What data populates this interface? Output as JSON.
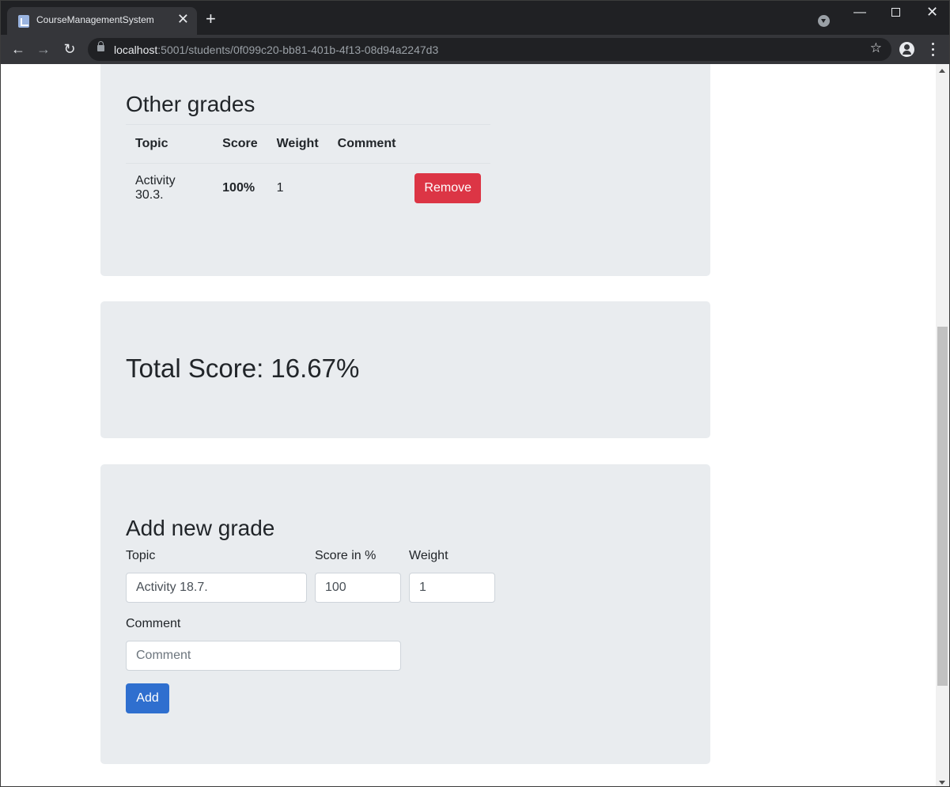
{
  "browser": {
    "tab_title": "CourseManagementSystem",
    "tab_close": "✕",
    "new_tab": "+",
    "url_host": "localhost",
    "url_rest": ":5001/students/0f099c20-bb81-401b-4f13-08d94a2247d3",
    "window_min": "—",
    "window_close": "✕",
    "back": "←",
    "forward": "→",
    "reload": "↻",
    "star": "☆"
  },
  "other_grades": {
    "title": "Other grades",
    "columns": [
      "Topic",
      "Score",
      "Weight",
      "Comment"
    ],
    "rows": [
      {
        "topic": "Activity 30.3.",
        "score": "100%",
        "weight": "1",
        "comment": "",
        "action": "Remove"
      }
    ]
  },
  "total": {
    "text": "Total Score: 16.67%"
  },
  "add_grade": {
    "title": "Add new grade",
    "topic_label": "Topic",
    "topic_value": "Activity 18.7.",
    "score_label": "Score in %",
    "score_value": "100",
    "weight_label": "Weight",
    "weight_value": "1",
    "comment_label": "Comment",
    "comment_placeholder": "Comment",
    "add_label": "Add"
  }
}
